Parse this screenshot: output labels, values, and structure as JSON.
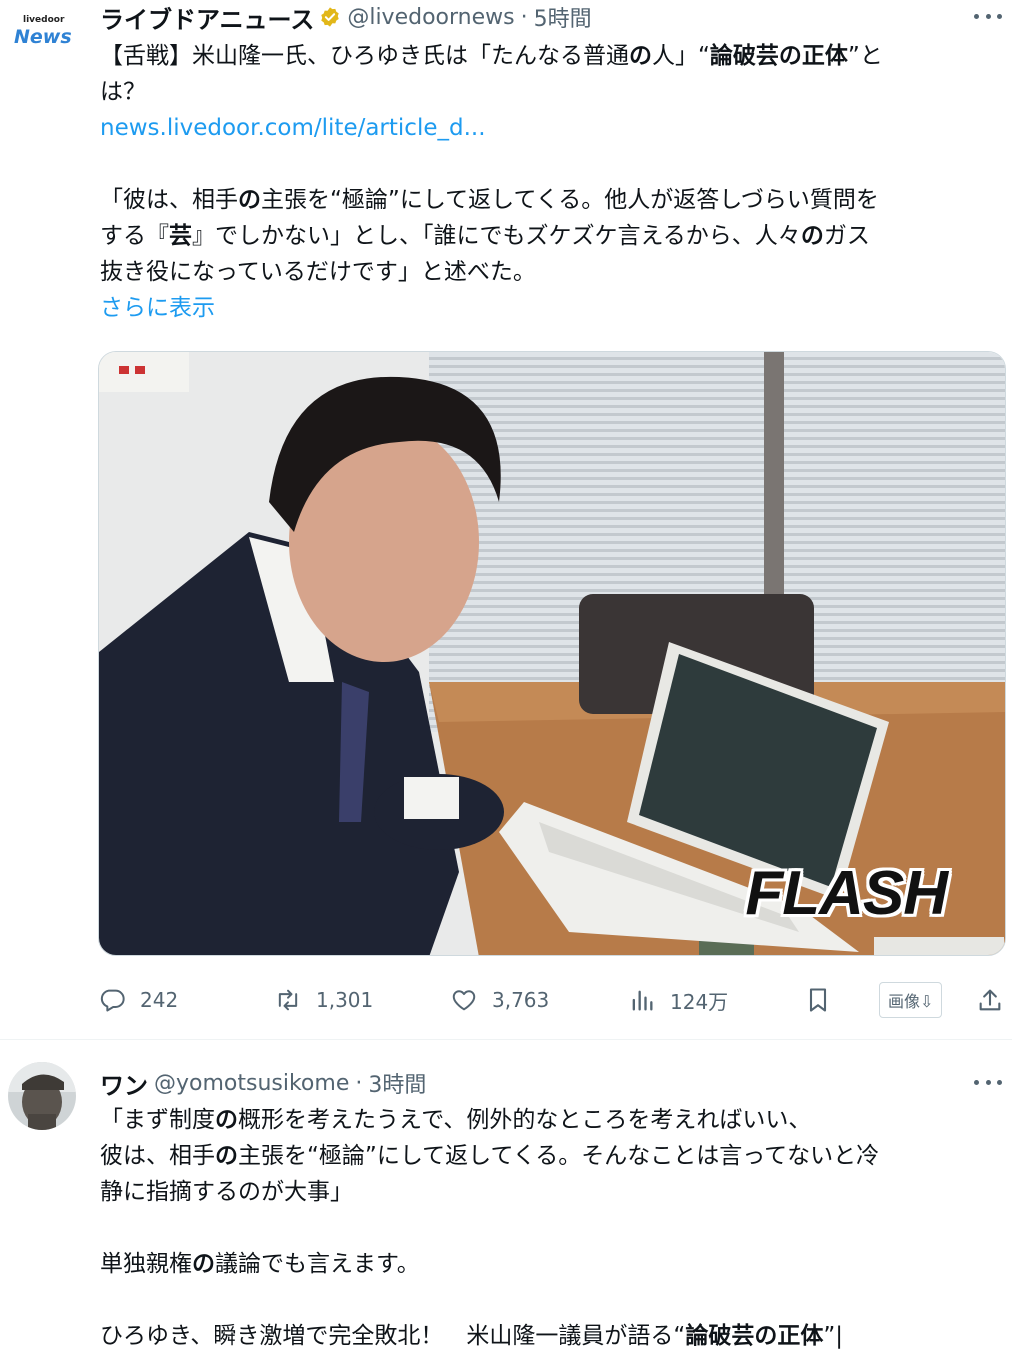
{
  "tweet1": {
    "logo": {
      "small": "livedoor",
      "large": "News"
    },
    "display_name": "ライブドアニュース",
    "handle": "@livedoornews",
    "separator": "·",
    "time": "5時間",
    "text": {
      "l1a": "【舌戦】米山隆一氏、ひろゆき氏は「たんなる普通",
      "l1b": "の",
      "l1c": "人」“",
      "l1d": "論破芸の正体",
      "l1e": "”と",
      "l2": "は？",
      "link": "news.livedoor.com/lite/article_d...",
      "l4a": "「彼は、相手",
      "l4b": "の",
      "l4c": "主張を“極論”にして返してくる。他人が返答しづらい質問を",
      "l5a": "する『",
      "l5b": "芸",
      "l5c": "』でしかない」とし、「誰にでもズケズケ言えるから、人々",
      "l5d": "の",
      "l5e": "ガス",
      "l6": "抜き役になっているだけです」と述べた。",
      "show_more": "さらに表示"
    },
    "image_badge": "FLASH",
    "actions": {
      "replies": "242",
      "retweets": "1,301",
      "likes": "3,763",
      "views": "124万",
      "image_download": "画像⇩"
    }
  },
  "tweet2": {
    "display_name": "ワン",
    "handle": "@yomotsusikome",
    "separator": "·",
    "time": "3時間",
    "text": {
      "l1a": "「まず制度",
      "l1b": "の",
      "l1c": "概形を考えたうえで、例外的なところを考えればいい、",
      "l2a": "彼は、相手",
      "l2b": "の",
      "l2c": "主張を“極論”にして返してくる。そんなことは言ってないと冷",
      "l3": "静に指摘するのが大事」",
      "l5a": "単独親権",
      "l5b": "の",
      "l5c": "議論でも言えます。",
      "l7a": "ひろゆき、瞬き激増で完全敗北！　米山隆一議員が語る“",
      "l7b": "論破芸の正体",
      "l7c": "”|"
    }
  }
}
